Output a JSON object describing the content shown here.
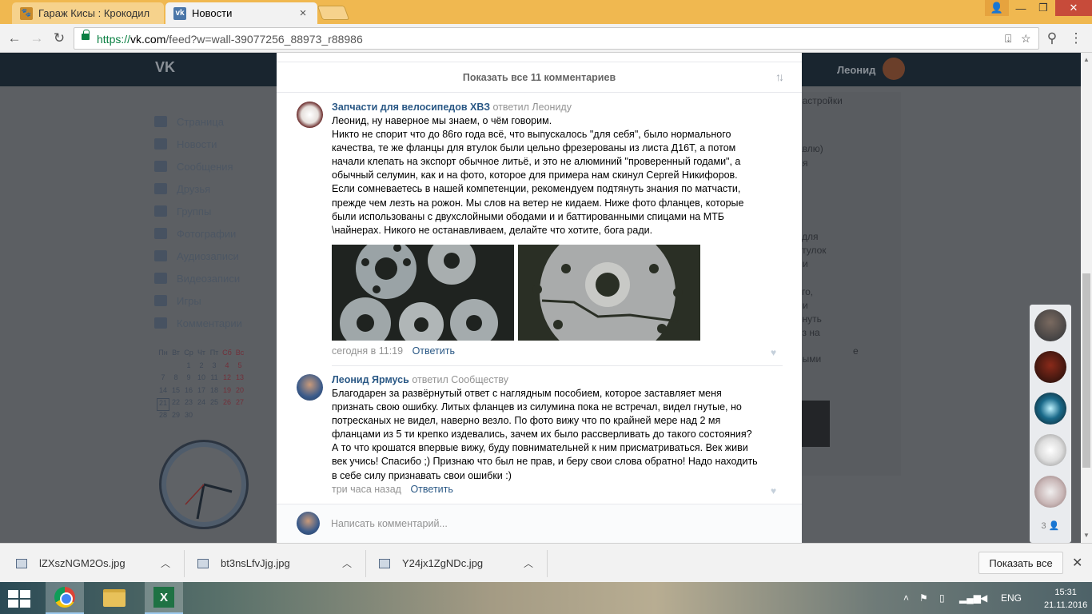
{
  "browser": {
    "tabs": [
      {
        "title": "Гараж Кисы : Крокодил",
        "favicon": "paw-icon",
        "active": false
      },
      {
        "title": "Новости",
        "favicon": "vk-icon",
        "active": true
      }
    ],
    "url_scheme": "https://",
    "url_host": "vk.com",
    "url_path": "/feed?w=wall-39077256_88973_r88986"
  },
  "vk": {
    "logo": "VK",
    "user_name": "Леонид",
    "menu": [
      "Страница",
      "Новости",
      "Сообщения",
      "Друзья",
      "Группы",
      "Фотографии",
      "Аудиозаписи",
      "Видеозаписи",
      "Игры",
      "Комментарии"
    ],
    "calendar": {
      "weekdays": [
        "Пн",
        "Вт",
        "Ср",
        "Чт",
        "Пт",
        "Сб",
        "Вс"
      ],
      "rows": [
        [
          "",
          "",
          "1",
          "2",
          "3",
          "4",
          "5"
        ],
        [
          "7",
          "8",
          "9",
          "10",
          "11",
          "12",
          "13"
        ],
        [
          "14",
          "15",
          "16",
          "17",
          "18",
          "19",
          "20"
        ],
        [
          "21",
          "22",
          "23",
          "24",
          "25",
          "26",
          "27"
        ],
        [
          "28",
          "29",
          "30",
          "",
          "",
          "",
          ""
        ]
      ],
      "today": "21"
    },
    "right_fragments": [
      "настройки",
      "авлю)",
      "ля",
      "для",
      "втулок",
      "ли",
      "го,",
      "ли",
      "януть",
      "оз на",
      "ными",
      "е"
    ]
  },
  "post": {
    "show_all_comments": "Показать все 11 комментариев",
    "comments": [
      {
        "author": "Запчасти для велосипедов ХВЗ",
        "reply_to": "ответил Леониду",
        "lines": [
          "Леонид, ну наверное мы знаем, о чём говорим.",
          "Никто не спорит что до 86го года всё, что выпускалось \"для себя\", было нормального",
          "качества, те же фланцы для втулок были цельно фрезерованы из листа Д16Т, а потом",
          "начали клепать на экспорт обычное литьё, и это не алюминий \"проверенный годами\", а",
          "обычный селумин, как и на фото, которое для примера нам скинул Сергей Никифоров.",
          "Если сомневаетесь в нашей компетенции, рекомендуем подтянуть знания по матчасти,",
          "прежде чем лезть на рожон. Мы слов на ветер не кидаем. Ниже фото фланцев, которые",
          "были использованы с двухслойными ободами и и баттированными спицами на МТБ",
          "\\найнерах. Никого не останавливаем, делайте что хотите, бога ради."
        ],
        "date": "сегодня в 11:19",
        "reply_label": "Ответить"
      },
      {
        "author": "Леонид Ярмусь",
        "reply_to": "ответил Сообществу",
        "lines": [
          "Благодарен за развёрнутый ответ с наглядным пособием, которое заставляет меня",
          "признать свою ошибку. Литых фланцев из силумина пока не встречал, видел гнутые, но",
          "потресканых не видел, наверно везло. По фото вижу что по крайней мере над 2 мя",
          "фланцами из 5 ти крепко издевались, зачем их было рассверливать до такого состояния?",
          "А то что крошатся впервые вижу, буду повнимательней к ним присматриваться. Век живи",
          "век учись! Спасибо ;) Признаю что был не прав, и беру свои слова обратно! Надо находить",
          "в себе силу признавать свои ошибки :)"
        ],
        "date": "три часа назад",
        "reply_label": "Ответить"
      }
    ],
    "new_comment_placeholder": "Написать комментарий..."
  },
  "chat": {
    "count": "3"
  },
  "downloads": {
    "items": [
      "lZXszNGM2Os.jpg",
      "bt3nsLfvJjg.jpg",
      "Y24jx1ZgNDc.jpg"
    ],
    "show_all": "Показать все"
  },
  "taskbar": {
    "lang": "ENG",
    "time": "15:31",
    "date": "21.11.2016"
  }
}
